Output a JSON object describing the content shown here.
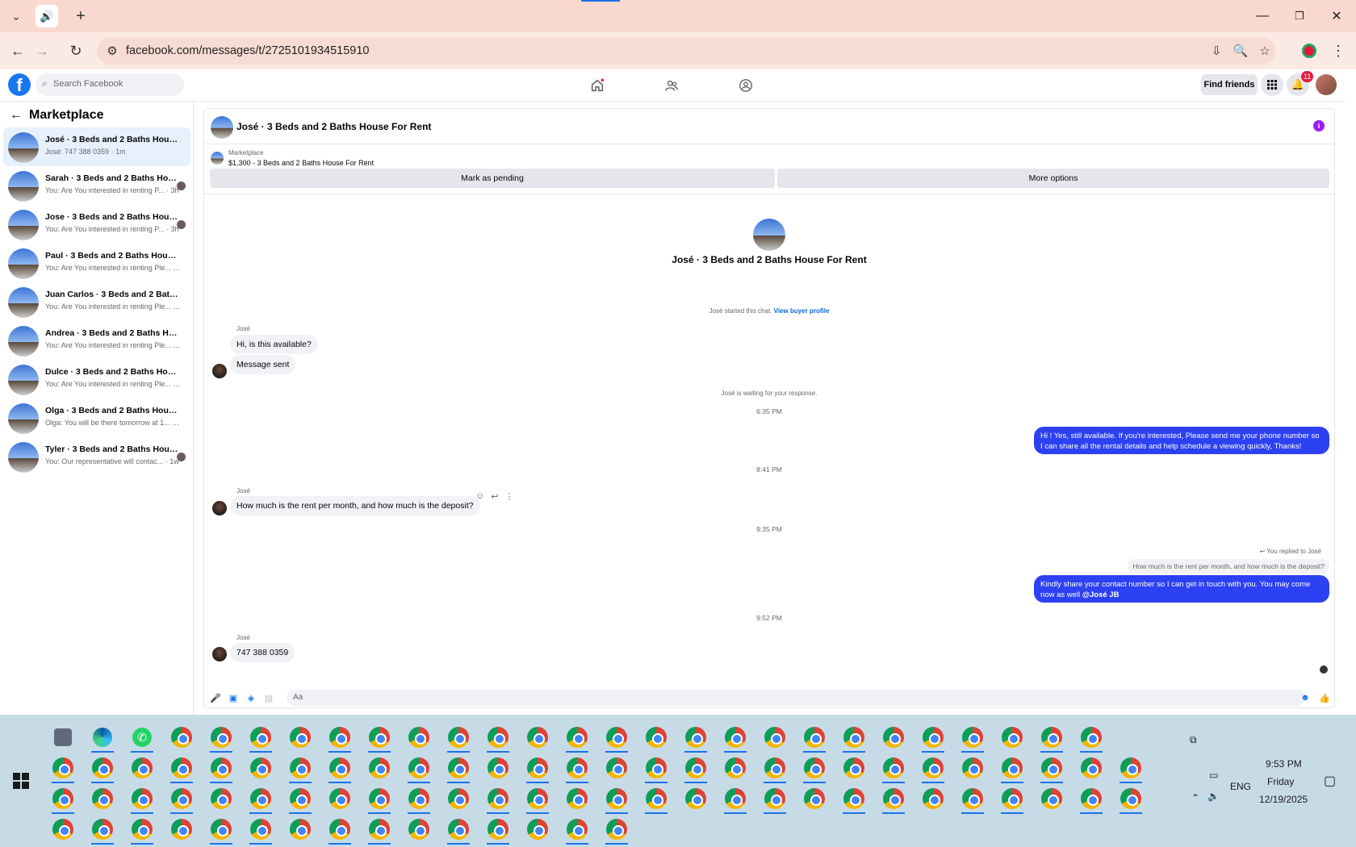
{
  "browser": {
    "url": "facebook.com/messages/t/2725101934515910"
  },
  "facebook": {
    "search_placeholder": "Search Facebook",
    "find_friends": "Find friends",
    "notification_count": "11"
  },
  "sidebar": {
    "title": "Marketplace",
    "conversations": [
      {
        "name": "José · 3 Beds and 2 Baths House F...",
        "preview": "José: 747 388 0359 · 1m",
        "active": true
      },
      {
        "name": "Sarah · 3 Beds and 2 Baths Hous...",
        "preview": "You: Are You interested in renting P... · 3h"
      },
      {
        "name": "Jose · 3 Beds and 2 Baths House...",
        "preview": "You: Are You interested in renting P... · 3h"
      },
      {
        "name": "Paul · 3 Beds and 2 Baths House F...",
        "preview": "You: Are You interested in renting Ple... · 3h"
      },
      {
        "name": "Juan Carlos · 3 Beds and 2 Baths H...",
        "preview": "You: Are You interested in renting Ple... · 3h"
      },
      {
        "name": "Andrea · 3 Beds and 2 Baths Hous...",
        "preview": "You: Are You interested in renting Ple... · 3h"
      },
      {
        "name": "Dulce · 3 Beds and 2 Baths House ...",
        "preview": "You: Are You interested in renting Ple... · 3h"
      },
      {
        "name": "Olga · 3 Beds and 2 Baths House F...",
        "preview": "Olga: You will be there tomorrow at 1... · 4d"
      },
      {
        "name": "Tyler · 3 Beds and 2 Baths Hous...",
        "preview": "You: Our representative will contac... · 1w"
      }
    ]
  },
  "chat": {
    "title": "José · 3 Beds and 2 Baths House For Rent",
    "listing_source": "Marketplace",
    "listing_price": "$1,300 - 3 Beds and 2 Baths House For Rent",
    "mark_pending": "Mark as pending",
    "more_options": "More options",
    "hero_title": "José · 3 Beds and 2 Baths House For Rent",
    "started_text": "José started this chat.",
    "view_profile": "View buyer profile",
    "sender": "José",
    "msg1": "Hi, is this available?",
    "msg2": "Message sent",
    "waiting": "José is waiting for your response.",
    "ts1": "6:35 PM",
    "out1": "Hi ! Yes, still available. If you're interested, Please send me your phone number so I can share all the rental details and help schedule a viewing quickly, Thanks!",
    "ts2": "8:41 PM",
    "msg3": "How much is the rent per month, and how much is the deposit?",
    "ts3": "9:35 PM",
    "replied_to": "You replied to José",
    "quoted": "How much is the rent per month, and how much is the deposit?",
    "out2_text": "Kindly share your contact number so I can get in touch with you. You may come now as well ",
    "out2_mention": "@José JB",
    "ts4": "9:52 PM",
    "msg4": "747 388 0359",
    "composer_placeholder": "Aa"
  },
  "taskbar": {
    "language": "ENG",
    "time": "9:53 PM",
    "day": "Friday",
    "date": "12/19/2025"
  }
}
